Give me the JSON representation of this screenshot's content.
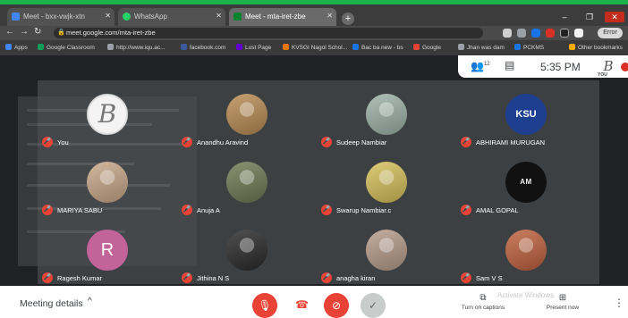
{
  "browser": {
    "tabs": [
      {
        "label": "Meet - bxx-vwjk-xtn",
        "color": "#4285f4",
        "active": false
      },
      {
        "label": "WhatsApp",
        "color": "#25d366",
        "active": false
      },
      {
        "label": "Meet - mta-iret-zbe",
        "color": "#00832d",
        "active": true
      },
      {
        "label": "",
        "color": "#888888",
        "active": false
      }
    ],
    "new_tab": "+",
    "url": "meet.google.com/mta-iret-zbe",
    "error_label": "Error",
    "bookmarks": [
      "Apps",
      "Google Classroom",
      "http://www.iqu.ac...",
      "facebook.com",
      "Lost Page",
      "KVSGI Nagol Schol...",
      "Bac ba new - bs",
      "Google",
      "Jhan was dam",
      "PCKMS",
      "Other bookmarks"
    ]
  },
  "meet": {
    "top_bar": {
      "people_count": "12",
      "time": "5:35 PM",
      "you_label": "YOU",
      "you_avatar_letter": "B"
    },
    "participants": [
      {
        "name": "You",
        "avatar_type": "logo",
        "avatar_text": "B",
        "color": "#f4f4f4"
      },
      {
        "name": "Anandhu Aravind",
        "avatar_type": "photo",
        "avatar_text": "",
        "color": "#b98c54"
      },
      {
        "name": "Sudeep Nambiar",
        "avatar_type": "photo",
        "avatar_text": "",
        "color": "#9fb3a7"
      },
      {
        "name": "ABHIRAMI MURUGAN",
        "avatar_type": "badge",
        "avatar_text": "KSU",
        "color": "#1e3f8f"
      },
      {
        "name": "MARIYA SABU",
        "avatar_type": "photo",
        "avatar_text": "",
        "color": "#c9a88a"
      },
      {
        "name": "Anuja A",
        "avatar_type": "photo",
        "avatar_text": "",
        "color": "#6f7a54"
      },
      {
        "name": "Swarup Nambiar.c",
        "avatar_type": "photo",
        "avatar_text": "",
        "color": "#d6c15a"
      },
      {
        "name": "AMAL GOPAL",
        "avatar_type": "text",
        "avatar_text": "AM ALONE",
        "color": "#111111"
      },
      {
        "name": "Ragesh Kumar",
        "avatar_type": "letter",
        "avatar_text": "R",
        "color": "#c2639a"
      },
      {
        "name": "Jithina N S",
        "avatar_type": "photo",
        "avatar_text": "",
        "color": "#2a2a2a"
      },
      {
        "name": "anagha kiran",
        "avatar_type": "photo",
        "avatar_text": "",
        "color": "#b79c8a"
      },
      {
        "name": "Sam V S",
        "avatar_type": "photo",
        "avatar_text": "",
        "color": "#c0623e"
      }
    ],
    "bottom_bar": {
      "meeting_details": "Meeting details",
      "captions_label": "Turn on captions",
      "present_label": "Present now",
      "activate_windows": "Activate Windows"
    }
  },
  "colors": {
    "mic_off": "#ea4335",
    "meet_bg": "#202124",
    "tile_bg": "#3c4043",
    "check": "#c8ccca"
  }
}
